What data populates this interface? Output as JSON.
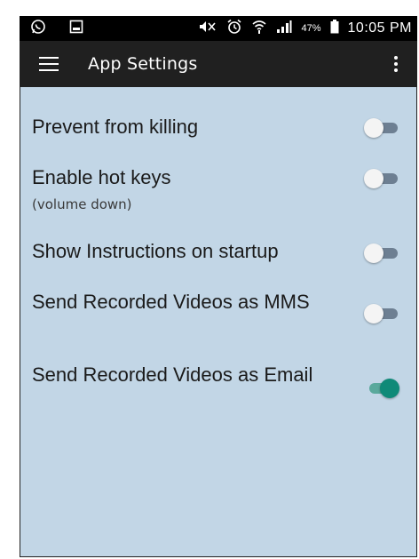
{
  "status_bar": {
    "icons": [
      "whatsapp-icon",
      "image-icon",
      "mute-icon",
      "alarm-icon",
      "wifi-icon",
      "signal-icon",
      "battery-icon"
    ],
    "battery_percent": "47%",
    "time": "10:05 PM"
  },
  "toolbar": {
    "title": "App Settings",
    "menu_icon": "hamburger-menu-icon",
    "overflow_icon": "more-vert-icon"
  },
  "settings": [
    {
      "label": "Prevent from killing",
      "sub": "",
      "enabled": false
    },
    {
      "label": "Enable hot keys",
      "sub": "(volume down)",
      "enabled": false
    },
    {
      "label": "Show Instructions on startup",
      "sub": "",
      "enabled": false
    },
    {
      "label": "Send Recorded Videos as MMS",
      "sub": "",
      "enabled": false
    },
    {
      "label": "Send Recorded Videos as Email",
      "sub": "",
      "enabled": true
    }
  ],
  "colors": {
    "background": "#c2d6e6",
    "toolbar": "#202020",
    "switch_on": "#0f8a78",
    "switch_off_track": "#6d7f92"
  }
}
